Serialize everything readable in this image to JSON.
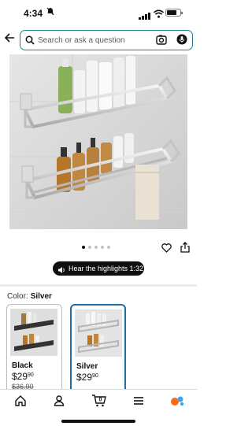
{
  "status_bar": {
    "time": "4:34"
  },
  "search": {
    "placeholder": "Search or ask a question"
  },
  "image_carousel": {
    "count": 5,
    "active_index": 0
  },
  "highlights": {
    "label": "Hear the highlights 1:32"
  },
  "color": {
    "label": "Color:",
    "selected": "Silver"
  },
  "variants": [
    {
      "name": "Black",
      "price_whole": "$29",
      "price_cents": "90",
      "list_price": "$36.90",
      "selected": false
    },
    {
      "name": "Silver",
      "price_whole": "$29",
      "price_cents": "90",
      "list_price": "",
      "selected": true
    }
  ],
  "bottom_nav": {
    "cart_count": "0",
    "items": [
      "home-icon",
      "account-icon",
      "cart-icon",
      "menu-icon",
      "ai-assistant-icon"
    ]
  },
  "colors": {
    "accent_teal": "#1f7e8c",
    "selected_border": "#1d6fa5",
    "text": "#0f1111"
  }
}
